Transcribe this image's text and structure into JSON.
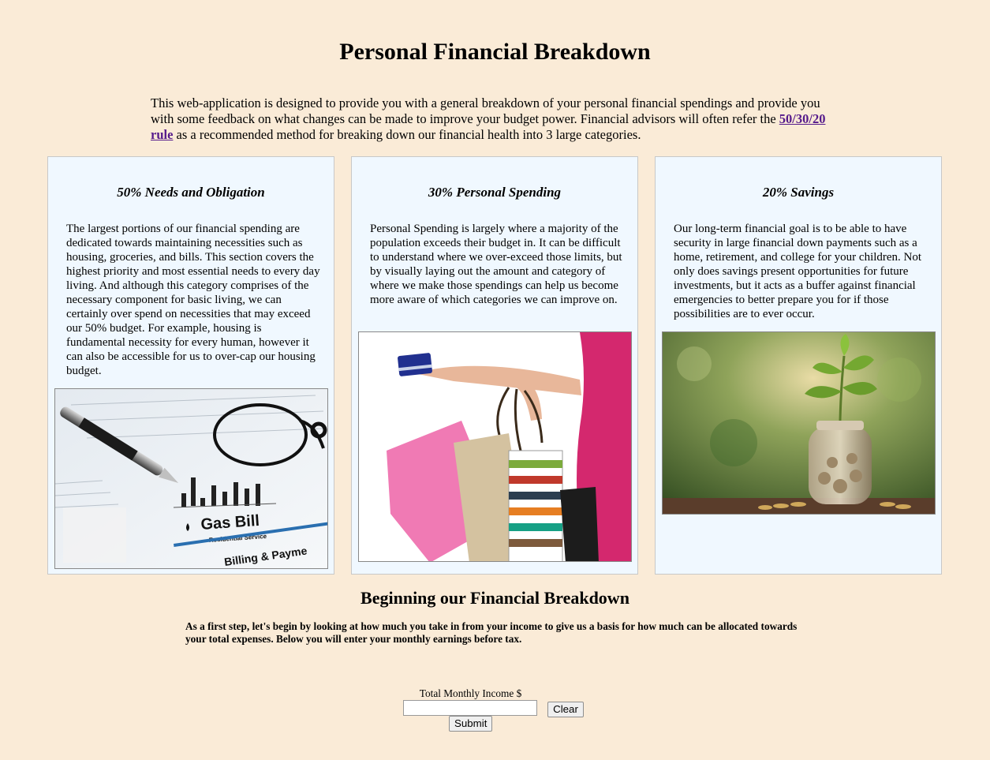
{
  "page": {
    "title": "Personal Financial Breakdown",
    "intro_before_link": "This web-application is designed to provide you with a general breakdown of your personal financial spendings and provide you with some feedback on what changes can be made to improve your budget power. Financial advisors will often refer the ",
    "intro_link": "50/30/20 rule",
    "intro_after_link": " as a recommended method for breaking down our financial health into 3 large categories."
  },
  "cards": [
    {
      "title": "50% Needs and Obligation",
      "text": "The largest portions of our financial spending are dedicated towards maintaining necessities such as housing, groceries, and bills. This section covers the highest priority and most essential needs to every day living. And although this category comprises of the necessary component for basic living, we can certainly over spend on necessities that may exceed our 50% budget. For example, housing is fundamental necessity for every human, however it can also be accessible for us to over-cap our housing budget.",
      "image": {
        "icon": "gas-bill-document-photo",
        "label": "Gas Bill",
        "sublabel": "Residential Service",
        "footer": "Billing & Payme"
      }
    },
    {
      "title": "30% Personal Spending",
      "text": "Personal Spending is largely where a majority of the population exceeds their budget in. It can be difficult to understand where we over-exceed those limits, but by visually laying out the amount and category of where we make those spendings can help us become more aware of which categories we can improve on.",
      "image": {
        "icon": "shopping-bags-photo"
      }
    },
    {
      "title": "20% Savings",
      "text": "Our long-term financial goal is to be able to have security in large financial down payments such as a home, retirement, and college for your children. Not only does savings present opportunities for future investments, but it acts as a buffer against financial emergencies to better prepare you for if those possibilities are to ever occur.",
      "image": {
        "icon": "coin-jar-plant-photo"
      }
    }
  ],
  "section": {
    "title": "Beginning our Financial Breakdown",
    "text": "As a first step, let's begin by looking at how much you take in from your income to give us a basis for how much can be allocated towards your total expenses. Below you will enter your monthly earnings before tax."
  },
  "form": {
    "label": "Total Monthly Income $",
    "value": "",
    "clear_label": "Clear",
    "submit_label": "Submit"
  },
  "colors": {
    "background": "#faebd7",
    "card": "#f0f8ff",
    "link": "#551a8b"
  }
}
